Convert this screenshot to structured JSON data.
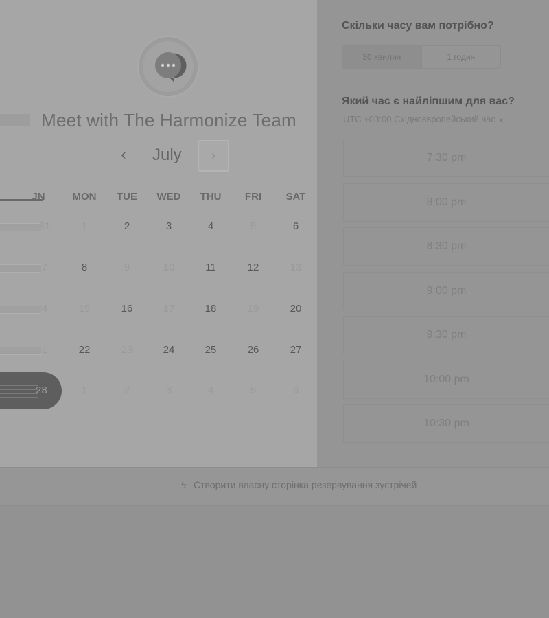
{
  "header": {
    "title": "Meet with The Harmonize Team"
  },
  "calendar": {
    "month": "July",
    "prev_icon": "chevron-left-icon",
    "next_icon": "chevron-right-icon",
    "weekdays": [
      "JN",
      "MON",
      "TUE",
      "WED",
      "THU",
      "FRI",
      "SAT"
    ],
    "weeks": [
      [
        {
          "d": "31",
          "a": false
        },
        {
          "d": "1",
          "a": false
        },
        {
          "d": "2",
          "a": true
        },
        {
          "d": "3",
          "a": true
        },
        {
          "d": "4",
          "a": true
        },
        {
          "d": "5",
          "a": false
        },
        {
          "d": "6",
          "a": true
        }
      ],
      [
        {
          "d": "7",
          "a": false
        },
        {
          "d": "8",
          "a": true
        },
        {
          "d": "9",
          "a": false
        },
        {
          "d": "10",
          "a": false
        },
        {
          "d": "11",
          "a": true
        },
        {
          "d": "12",
          "a": true
        },
        {
          "d": "13",
          "a": false
        }
      ],
      [
        {
          "d": "4",
          "a": false
        },
        {
          "d": "15",
          "a": false
        },
        {
          "d": "16",
          "a": true
        },
        {
          "d": "17",
          "a": false
        },
        {
          "d": "18",
          "a": true
        },
        {
          "d": "19",
          "a": false
        },
        {
          "d": "20",
          "a": true
        }
      ],
      [
        {
          "d": "1",
          "a": false
        },
        {
          "d": "22",
          "a": true
        },
        {
          "d": "23",
          "a": false
        },
        {
          "d": "24",
          "a": true
        },
        {
          "d": "25",
          "a": true
        },
        {
          "d": "26",
          "a": true
        },
        {
          "d": "27",
          "a": true
        }
      ],
      [
        {
          "d": "28",
          "a": false
        },
        {
          "d": "1",
          "a": false
        },
        {
          "d": "2",
          "a": false
        },
        {
          "d": "3",
          "a": false
        },
        {
          "d": "4",
          "a": false
        },
        {
          "d": "5",
          "a": false
        },
        {
          "d": "6",
          "a": false
        }
      ]
    ]
  },
  "duration": {
    "heading": "Скільки часу вам потрібно?",
    "options": [
      "30 хвилин",
      "1 годин"
    ],
    "selected": "30 хвилин"
  },
  "time": {
    "heading": "Який час є найліпшим для вас?",
    "timezone": "UTC +03:00 Східноєвропейський час",
    "slots": [
      "7:30 pm",
      "8:00 pm",
      "8:30 pm",
      "9:00 pm",
      "9:30 pm",
      "10:00 pm",
      "10:30 pm"
    ]
  },
  "footer": {
    "link_text": "Створити власну сторінка резервування зустрічей",
    "icon": "hubspot-sprocket-icon"
  },
  "colors": {
    "overlay": "#929292",
    "card": "#a6a6a6",
    "selected_pill": "#5e5e5e"
  }
}
